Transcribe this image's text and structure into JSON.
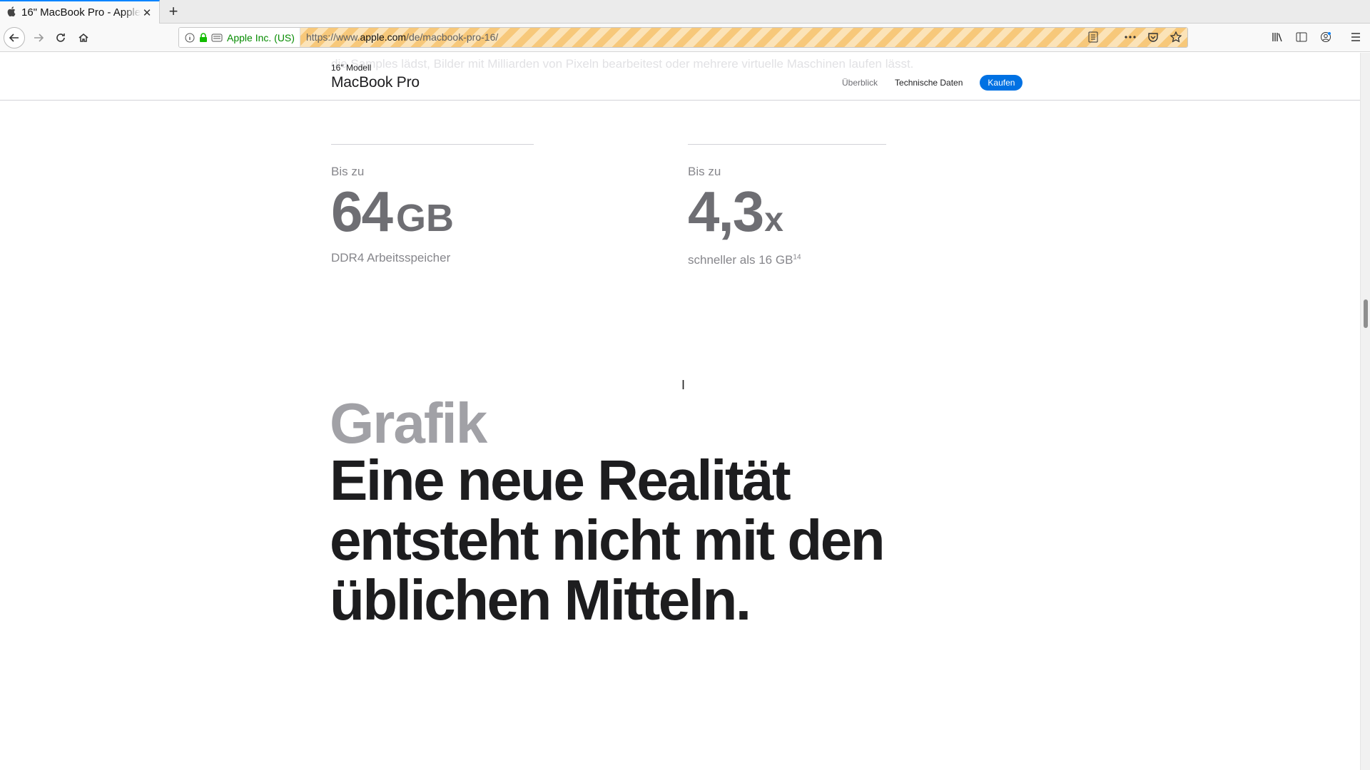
{
  "browser": {
    "tab": {
      "title": "16\" MacBook Pro - Apple",
      "favicon": "apple-icon"
    },
    "new_tab_label": "+",
    "identity": {
      "org": "Apple Inc. (US)"
    },
    "url": {
      "prefix": "https://www.",
      "domain": "apple.com",
      "path": "/de/macbook-pro-16/"
    }
  },
  "localnav": {
    "ghost_text": "die Samples lädst, Bilder mit Milliarden von Pixeln bearbeitest oder mehrere virtuelle Maschinen laufen lässt.",
    "eyebrow": "16\" Modell",
    "title": "MacBook Pro",
    "links": [
      "Überblick",
      "Technische Daten"
    ],
    "buy_label": "Kaufen"
  },
  "stats": [
    {
      "pre": "Bis zu",
      "value": "64",
      "unit": "GB",
      "desc": "DDR4 Arbeitsspeicher",
      "footnote": ""
    },
    {
      "pre": "Bis zu",
      "value": "4,3",
      "unit": "x",
      "desc": "schneller als 16 GB",
      "footnote": "14"
    }
  ],
  "section": {
    "eyebrow": "Grafik",
    "headline_lines": [
      "Eine neue Realität",
      "entsteht nicht mit den",
      "üblichen Mitteln."
    ]
  },
  "colors": {
    "accent": "#0071e3",
    "url_stripe": "#f7c87a",
    "identity_green": "#058b00"
  }
}
